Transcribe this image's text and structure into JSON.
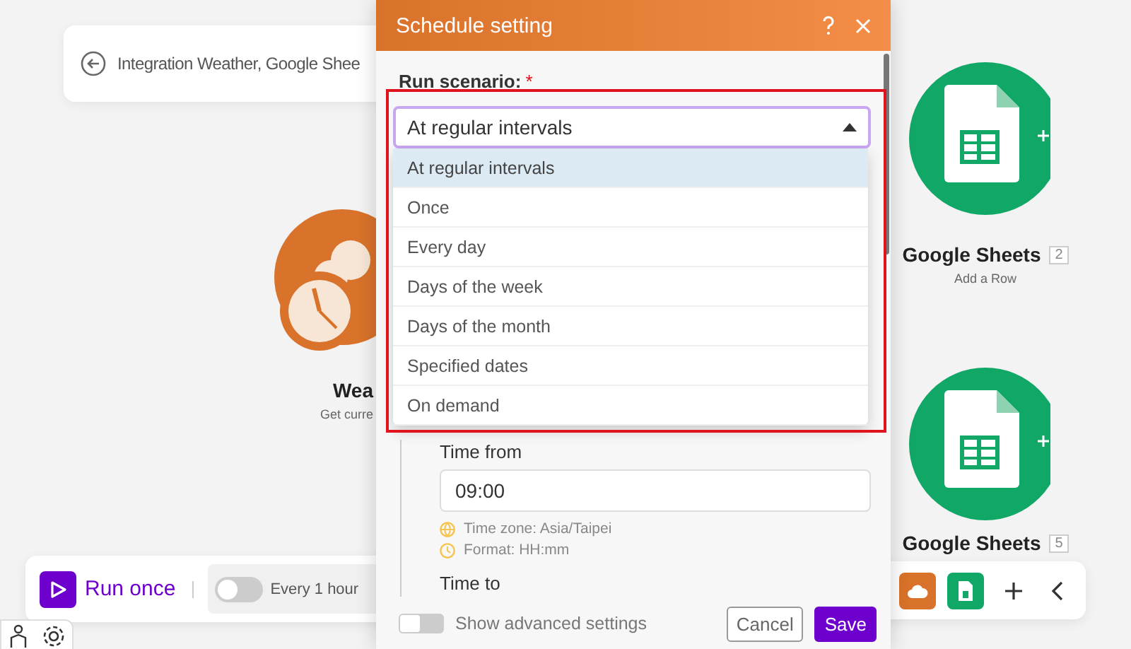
{
  "breadcrumb": {
    "title": "Integration Weather, Google Shee"
  },
  "nodes": [
    {
      "kind": "weather",
      "name": "Wea",
      "subtitle": "Get curre"
    },
    {
      "kind": "sheets",
      "name": "Google Sheets",
      "badge": "2",
      "subtitle": "Add a Row"
    },
    {
      "kind": "sheets",
      "name": "Google Sheets",
      "badge": "5"
    }
  ],
  "toolbar": {
    "run_label": "Run once",
    "schedule": {
      "on": false,
      "label": "Every 1 hour"
    }
  },
  "dialog": {
    "title": "Schedule setting",
    "field_label": "Run scenario:",
    "required_mark": "*",
    "select": {
      "value": "At regular intervals",
      "expanded": true
    },
    "options": [
      {
        "label": "At regular intervals",
        "selected": true
      },
      {
        "label": "Once",
        "selected": false
      },
      {
        "label": "Every day",
        "selected": false
      },
      {
        "label": "Days of the week",
        "selected": false
      },
      {
        "label": "Days of the month",
        "selected": false
      },
      {
        "label": "Specified dates",
        "selected": false
      },
      {
        "label": "On demand",
        "selected": false
      }
    ],
    "time_from": {
      "label": "Time from",
      "value": "09:00",
      "hints": [
        {
          "kind": "timezone",
          "text": "Time zone: Asia/Taipei"
        },
        {
          "kind": "format",
          "text": "Format: HH:mm"
        }
      ]
    },
    "time_to": {
      "label": "Time to"
    },
    "advanced": {
      "label": "Show advanced settings",
      "on": false
    },
    "buttons": [
      {
        "label": "Cancel",
        "kind": "secondary"
      },
      {
        "label": "Save",
        "kind": "primary"
      }
    ]
  }
}
